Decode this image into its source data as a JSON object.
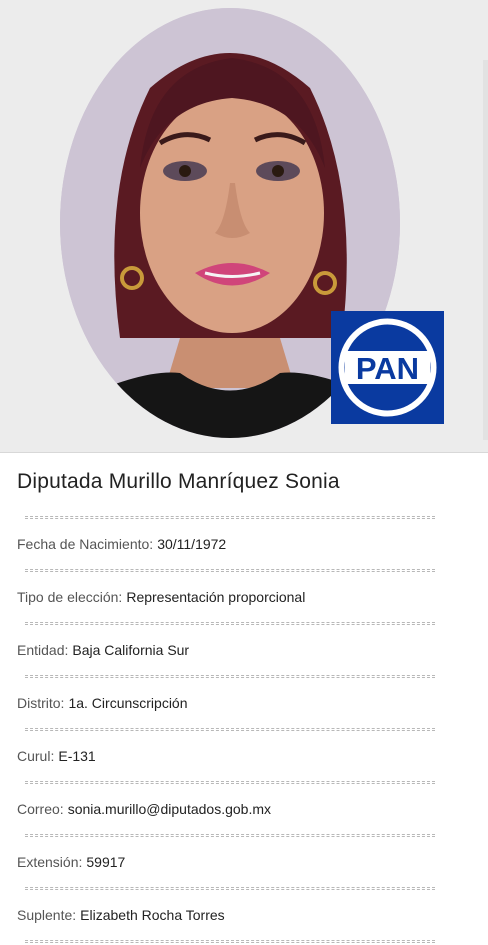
{
  "profile": {
    "title": "Diputada Murillo Manríquez Sonia",
    "party_logo_text": "PAN",
    "party_color": "#0a3aa0"
  },
  "fields": [
    {
      "label": "Fecha de Nacimiento:",
      "value": "30/11/1972"
    },
    {
      "label": "Tipo de elección:",
      "value": "Representación proporcional"
    },
    {
      "label": "Entidad:",
      "value": "Baja California Sur"
    },
    {
      "label": "Distrito:",
      "value": "1a. Circunscripción"
    },
    {
      "label": "Curul:",
      "value": "E-131"
    },
    {
      "label": "Correo:",
      "value": "sonia.murillo@diputados.gob.mx"
    },
    {
      "label": "Extensión:",
      "value": "59917"
    },
    {
      "label": "Suplente:",
      "value": "Elizabeth Rocha Torres"
    }
  ]
}
